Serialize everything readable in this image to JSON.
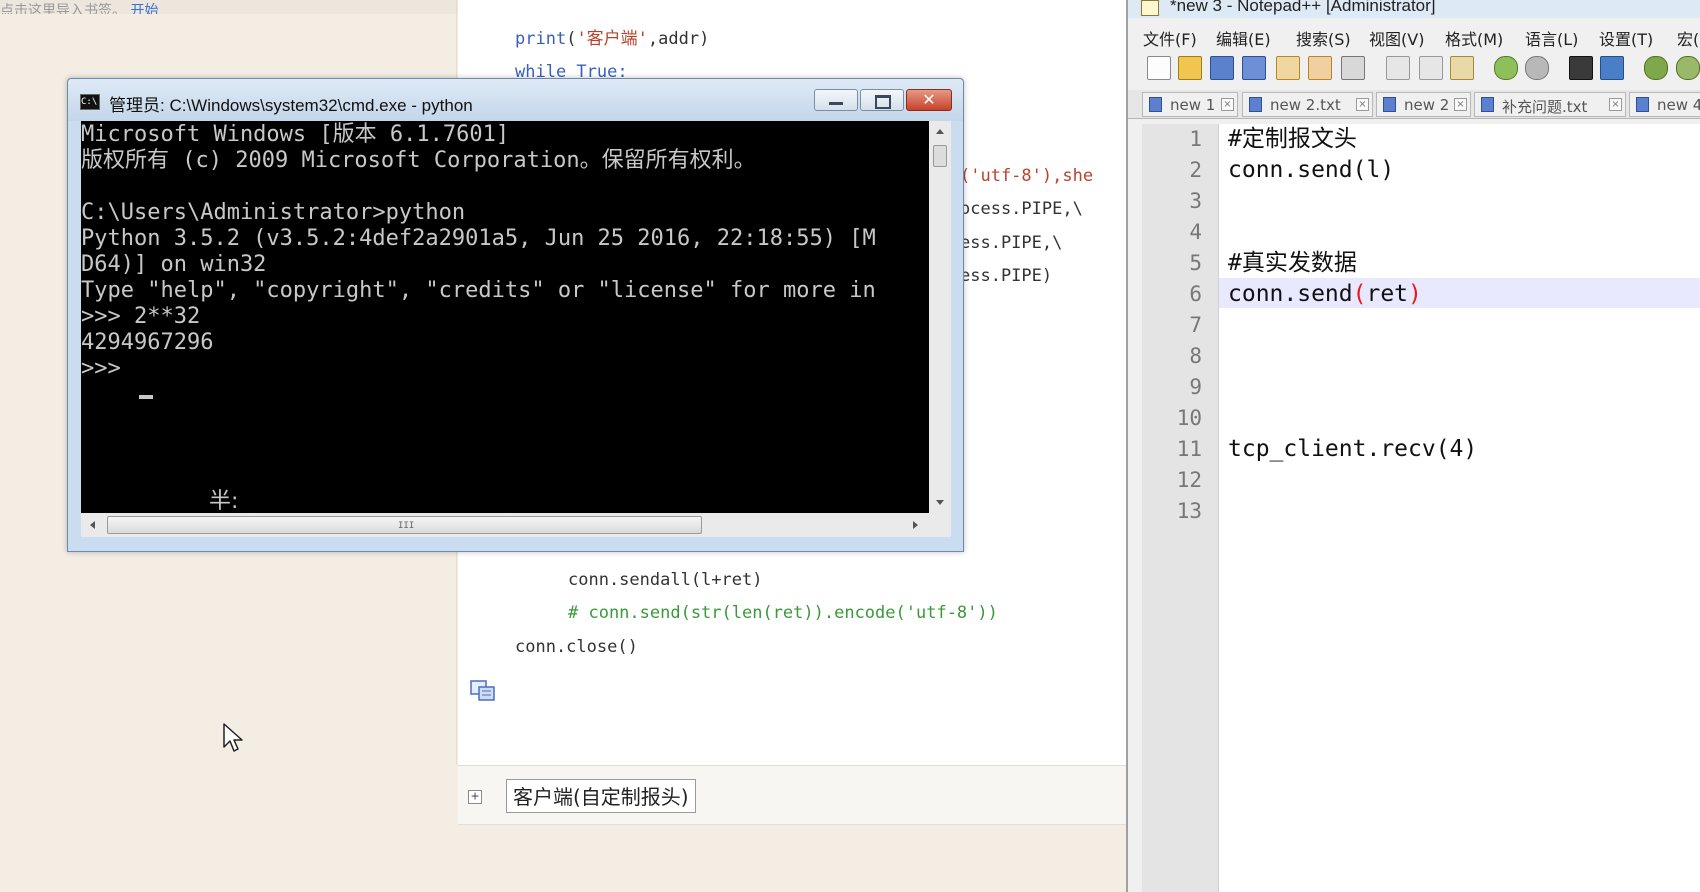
{
  "note_app": {
    "topbar_text": "点击这里导入书签。",
    "topbar_link": "开始",
    "code_top": {
      "line1": {
        "fn": "print",
        "open": "(",
        "str": "'客户端'",
        "rest": ",addr)"
      },
      "line2": {
        "kw": "while",
        "rest": " True:"
      }
    },
    "partial_lines": [
      "('utf-8'),she",
      "ocess.PIPE,\\",
      "ess.PIPE,\\",
      "ess.PIPE)"
    ],
    "code_bottom": {
      "line1": "conn.sendall(l+ret)",
      "line2_comment": "# conn.send(str(len(ret)).encode('utf-8'))",
      "line3": "conn.close()"
    },
    "block_expand_symbol": "+",
    "block_title": "客户端(自定制报头)"
  },
  "cmd_window": {
    "title": "管理员: C:\\Windows\\system32\\cmd.exe - python",
    "icon_text": "C:\\",
    "close_symbol": "✕",
    "console_lines": [
      "Microsoft Windows [版本 6.1.7601]",
      "版权所有 (c) 2009 Microsoft Corporation。保留所有权利。",
      "",
      "C:\\Users\\Administrator>python",
      "Python 3.5.2 (v3.5.2:4def2a2901a5, Jun 25 2016, 22:18:55) [M",
      "D64)] on win32",
      "Type \"help\", \"copyright\", \"credits\" or \"license\" for more in",
      ">>> 2**32",
      "4294967296",
      ">>> "
    ],
    "ime_status": "半:",
    "hscroll_grip": "III"
  },
  "notepadpp": {
    "title": "*new 3 - Notepad++ [Administrator]",
    "menu": [
      "文件(F)",
      "编辑(E)",
      "搜索(S)",
      "视图(V)",
      "格式(M)",
      "语言(L)",
      "设置(T)",
      "宏("
    ],
    "toolbar_icons": [
      "new-file-icon",
      "open-file-icon",
      "save-icon",
      "save-all-icon",
      "close-icon",
      "close-all-icon",
      "print-icon",
      "cut-icon",
      "copy-icon",
      "paste-icon",
      "undo-icon",
      "redo-icon",
      "find-icon",
      "replace-icon",
      "zoom-in-icon",
      "zoom-out-icon"
    ],
    "tabs": [
      "new 1",
      "new 2.txt",
      "new 2",
      "补充问题.txt",
      "new 4"
    ],
    "tab_close_symbol": "×",
    "line_numbers": [
      "1",
      "2",
      "3",
      "4",
      "5",
      "6",
      "7",
      "8",
      "9",
      "10",
      "11",
      "12",
      "13"
    ],
    "editor_lines": {
      "l1": "#定制报文头",
      "l2": "conn.send(l)",
      "l5": "#真实发数据",
      "l6_prefix": "conn.send",
      "l6_open": "(",
      "l6_arg": "ret",
      "l6_close": ")",
      "l11": "tcp_client.recv(4)"
    },
    "current_line": 6
  }
}
